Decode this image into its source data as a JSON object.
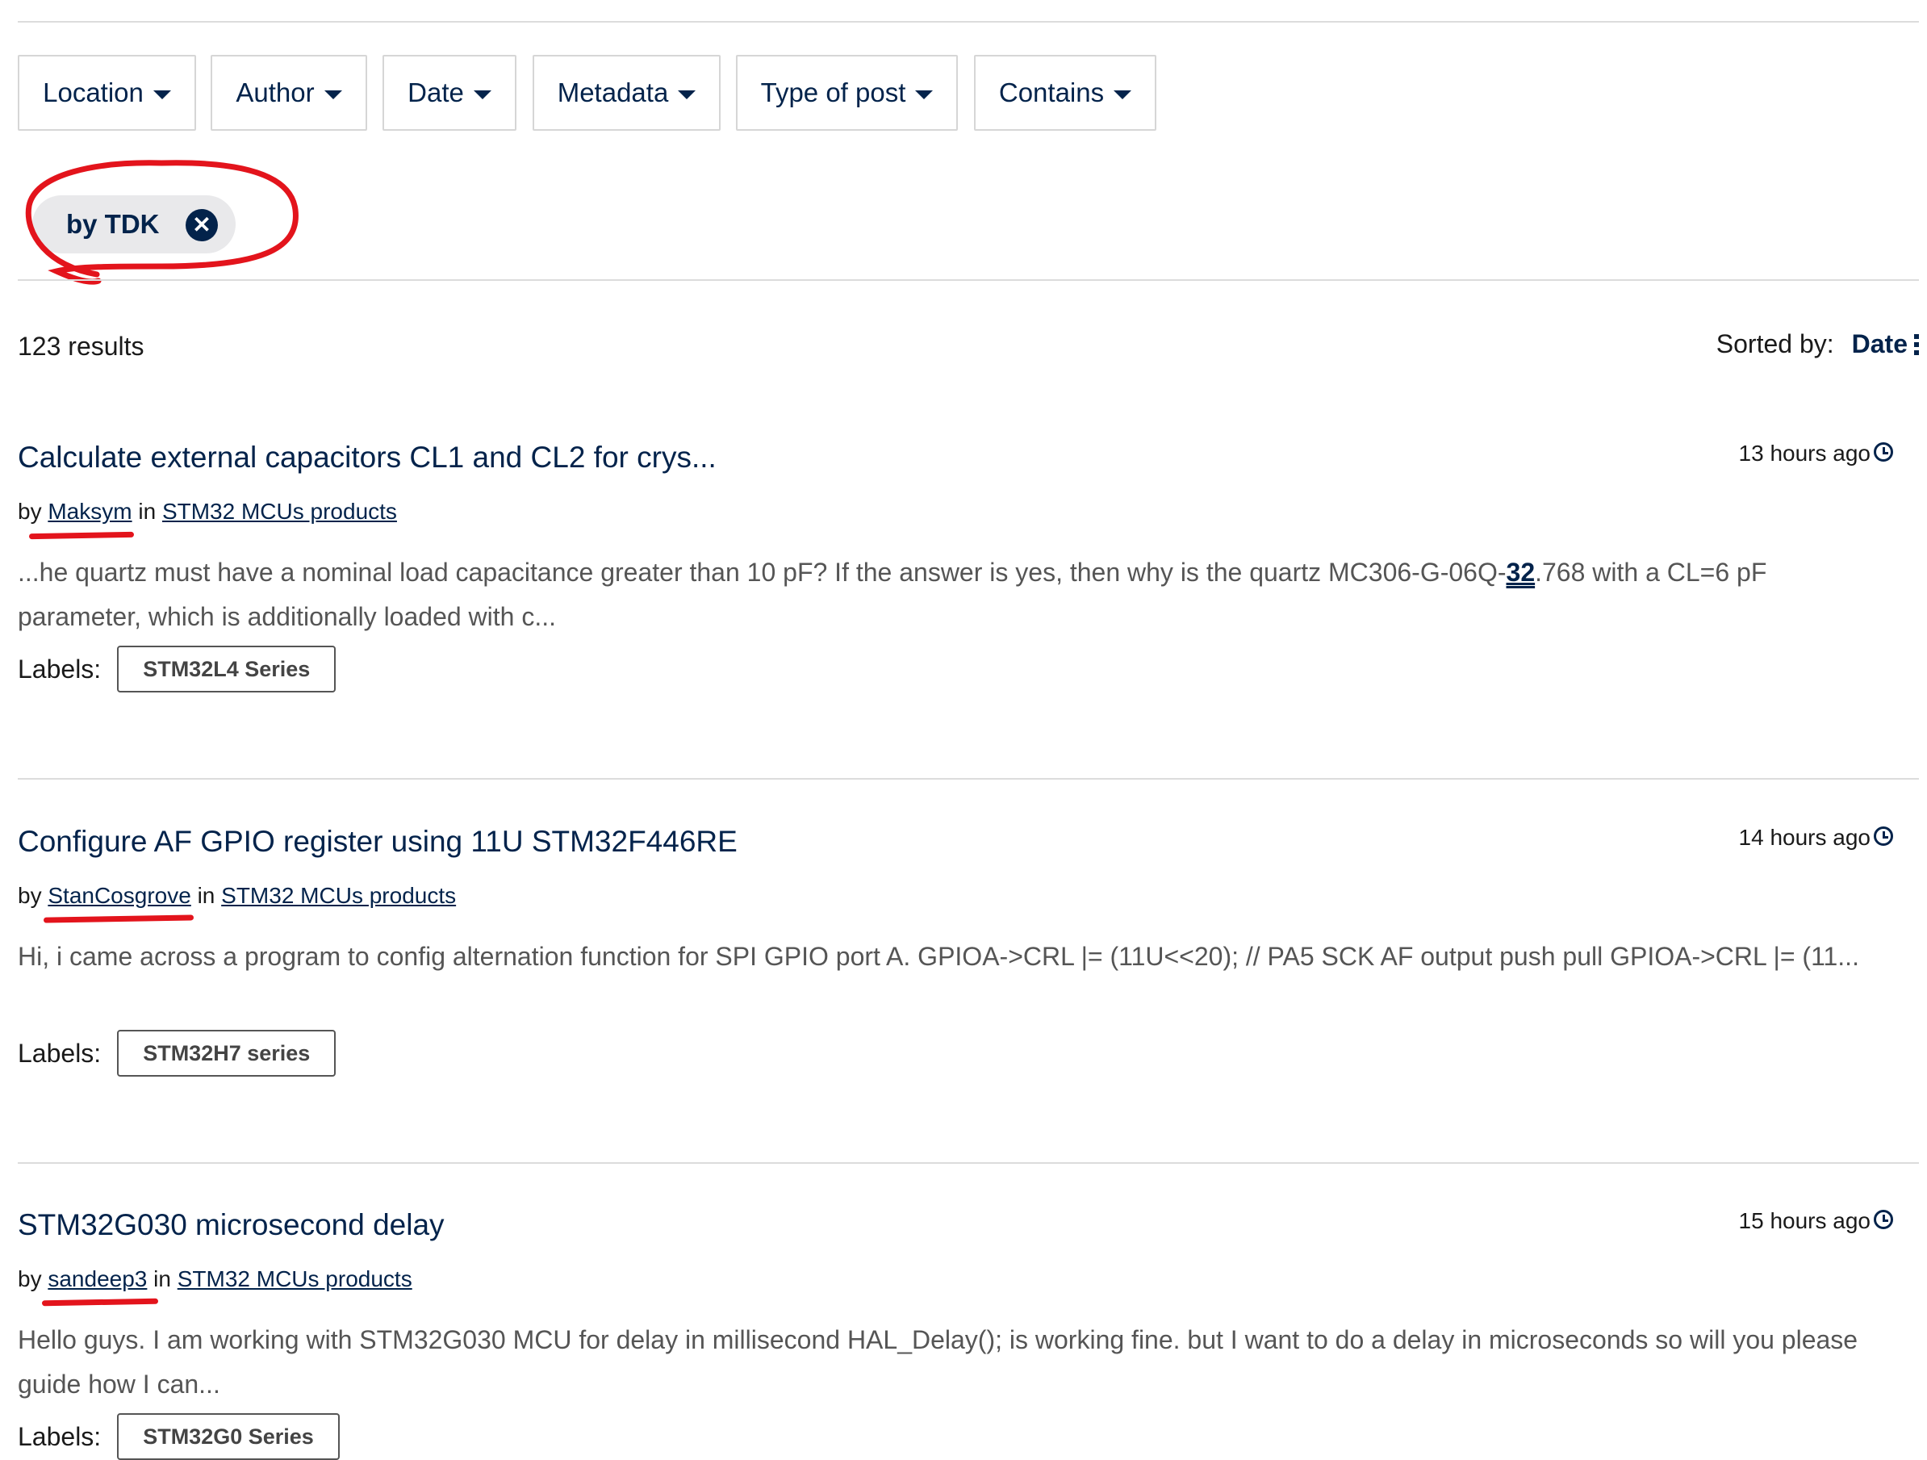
{
  "filters": [
    {
      "label": "Location"
    },
    {
      "label": "Author"
    },
    {
      "label": "Date"
    },
    {
      "label": "Metadata"
    },
    {
      "label": "Type of post"
    },
    {
      "label": "Contains"
    }
  ],
  "active_filter": {
    "label": "by TDK",
    "remove_icon": "close-icon"
  },
  "results": {
    "count_text": "123 results",
    "sorted_label": "Sorted by:",
    "sorted_value": "Date"
  },
  "posts": [
    {
      "title": "Calculate external capacitors CL1 and CL2 for crys...",
      "time": "13 hours ago",
      "by": "by",
      "author": "Maksym",
      "in": "in",
      "board": "STM32 MCUs products",
      "snippet_before": "...he quartz must have a nominal load capacitance greater than 10 pF? If the answer is yes, then why is the quartz MC306-G-06Q-",
      "snippet_highlight": "32",
      "snippet_after": ".768 with a CL=6 pF parameter, which is additionally loaded with c...",
      "labels_title": "Labels:",
      "label": "STM32L4 Series"
    },
    {
      "title": "Configure AF GPIO register using 11U STM32F446RE",
      "time": "14 hours ago",
      "by": "by",
      "author": "StanCosgrove",
      "in": "in",
      "board": "STM32 MCUs products",
      "snippet": "Hi, i came across a program to config alternation function for SPI GPIO port A.  GPIOA->CRL |= (11U<<20);       // PA5 SCK AF output push pull GPIOA->CRL |= (11...",
      "labels_title": "Labels:",
      "label": "STM32H7 series"
    },
    {
      "title": "STM32G030 microsecond delay",
      "time": "15 hours ago",
      "by": "by",
      "author": "sandeep3",
      "in": "in",
      "board": "STM32 MCUs products",
      "snippet": "Hello guys.   I am working with STM32G030 MCU for delay in millisecond  HAL_Delay(); is working fine. but I want to do a delay in microseconds  so will you please guide how I can...",
      "labels_title": "Labels:",
      "label": "STM32G0 Series"
    }
  ],
  "colors": {
    "brand": "#03234b",
    "annotation": "#e3141c",
    "chip_bg": "#e9e9eb"
  },
  "icons": {
    "clock": "clock-icon",
    "caret": "caret-down-icon",
    "sort": "kebab-menu-icon"
  }
}
